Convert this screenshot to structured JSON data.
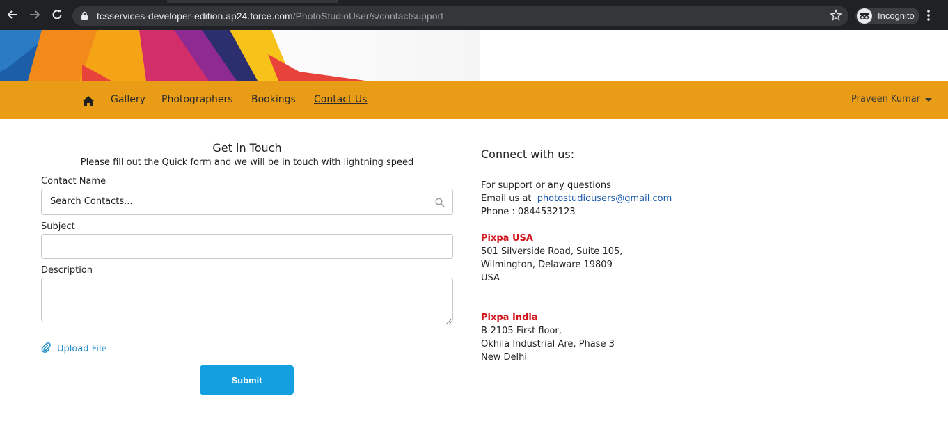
{
  "browser": {
    "url_host": "tcsservices-developer-edition.ap24.force.com",
    "url_path": "/PhotoStudioUser/s/contactsupport",
    "incognito_label": "Incognito"
  },
  "nav": {
    "items": [
      {
        "label": "Gallery"
      },
      {
        "label": "Photographers"
      },
      {
        "label": "Bookings"
      },
      {
        "label": "Contact Us"
      }
    ],
    "user_name": "Praveen Kumar"
  },
  "form": {
    "title": "Get in Touch",
    "subtitle": "Please fill out the Quick form and we will be in touch with lightning speed",
    "contact_label": "Contact Name",
    "contact_placeholder": "Search Contacts...",
    "subject_label": "Subject",
    "description_label": "Description",
    "upload_label": "Upload File",
    "submit_label": "Submit"
  },
  "connect": {
    "title": "Connect with us:",
    "support_line": "For support or any questions",
    "email_prefix": "Email us at",
    "email": "photostudiousers@gmail.com",
    "phone": "Phone : 0844532123",
    "offices": [
      {
        "name": "Pixpa USA",
        "lines": [
          "501 Silverside Road, Suite 105,",
          "Wilmington, Delaware 19809",
          "USA"
        ]
      },
      {
        "name": "Pixpa India",
        "lines": [
          "B-2105 First floor,",
          "Okhila Industrial Are, Phase 3",
          "New Delhi"
        ]
      }
    ]
  },
  "colors": {
    "navbar": "#e99c15",
    "submit": "#14a0e0",
    "office_title": "#d0141b",
    "link": "#1c5aa8"
  }
}
